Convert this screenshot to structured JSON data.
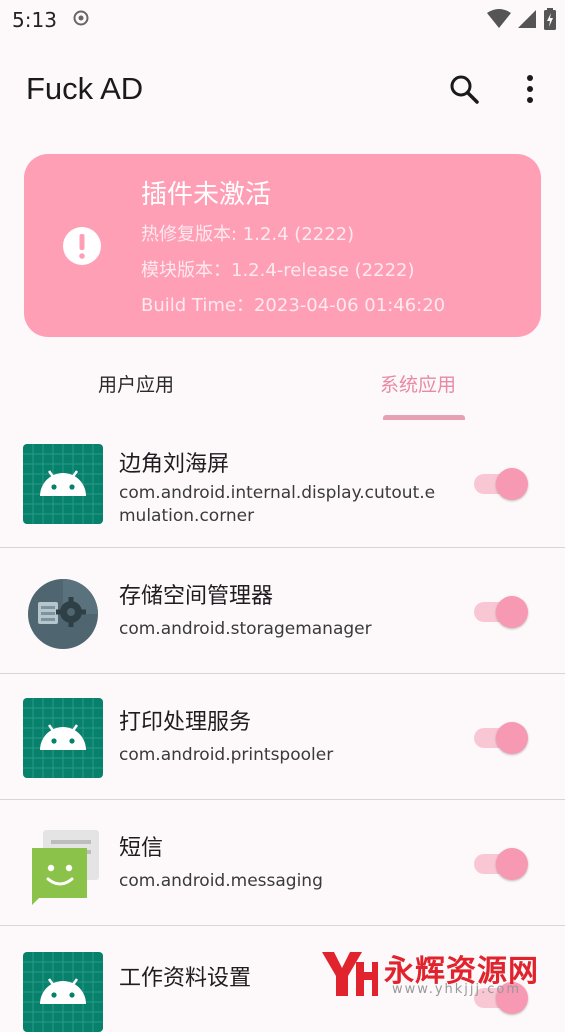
{
  "status_bar": {
    "time": "5:13",
    "icons": [
      "app-notification-icon",
      "wifi-icon",
      "signal-icon",
      "battery-icon"
    ]
  },
  "app_bar": {
    "title": "Fuck AD",
    "icons": [
      "search-icon",
      "more-vert-icon"
    ]
  },
  "status_card": {
    "title": "插件未激活",
    "hotfix_version": "热修复版本: 1.2.4 (2222)",
    "module_version": "模块版本：1.2.4-release (2222)",
    "build_time": "Build Time：2023-04-06 01:46:20",
    "icon": "alert-circle-icon",
    "color": "#ff9fb6"
  },
  "tabs": [
    {
      "label": "用户应用",
      "selected": false
    },
    {
      "label": "系统应用",
      "selected": true
    }
  ],
  "apps": [
    {
      "name": "边角刘海屏",
      "package": "com.android.internal.display.cutout.emulation.corner",
      "icon": "android-robot-icon",
      "enabled": true
    },
    {
      "name": "存储空间管理器",
      "package": "com.android.storagemanager",
      "icon": "storage-gear-icon",
      "enabled": true
    },
    {
      "name": "打印处理服务",
      "package": "com.android.printspooler",
      "icon": "android-robot-icon",
      "enabled": true
    },
    {
      "name": "短信",
      "package": "com.android.messaging",
      "icon": "messaging-smile-icon",
      "enabled": true
    },
    {
      "name": "工作资料设置",
      "package": "",
      "icon": "android-robot-icon",
      "enabled": true
    }
  ],
  "watermark": {
    "text": "永辉资源网",
    "url": "www.yhkjjj.com"
  },
  "colors": {
    "accent": "#f799b3",
    "background": "#fdf8fa"
  }
}
